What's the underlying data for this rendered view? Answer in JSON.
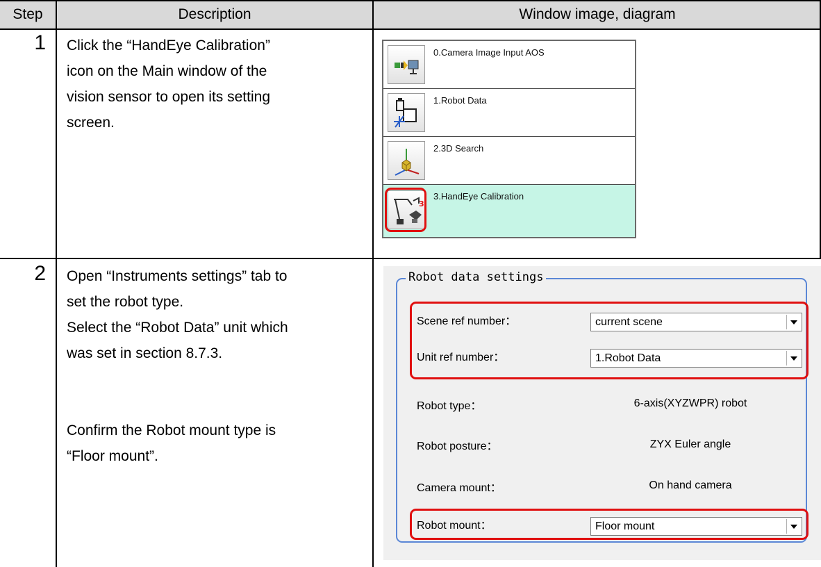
{
  "table": {
    "header": {
      "step": "Step",
      "description": "Description",
      "window_image": "Window image, diagram"
    },
    "steps": [
      {
        "number": "1",
        "lines": [
          "Click the “HandEye Calibration”",
          "icon on the Main window of the",
          "vision sensor to open its setting",
          "screen."
        ]
      },
      {
        "number": "2",
        "lines_a": [
          "Open “Instruments settings” tab to",
          "set the robot type.",
          "Select the “Robot Data” unit which",
          "was set in section 8.7.3."
        ],
        "lines_b": [
          "Confirm the Robot mount type is",
          "“Floor mount”."
        ]
      }
    ]
  },
  "unit_list": {
    "items": [
      {
        "label": "0.Camera Image Input AOS",
        "icon": "camera-input-icon",
        "selected": false
      },
      {
        "label": "1.Robot Data",
        "icon": "robot-data-icon",
        "selected": false
      },
      {
        "label": "2.3D Search",
        "icon": "3d-search-icon",
        "selected": false
      },
      {
        "label": "3.HandEye Calibration",
        "icon": "handeye-calibration-icon",
        "selected": true
      }
    ],
    "selected_color": "#c6f5e6",
    "highlight_color": "#e01010"
  },
  "robot_settings": {
    "group_title": "Robot data settings",
    "scene_ref": {
      "label": "Scene ref number：",
      "value": "current scene"
    },
    "unit_ref": {
      "label": "Unit ref number：",
      "value": "1.Robot Data"
    },
    "robot_type": {
      "label": "Robot type：",
      "value": "6-axis(XYZWPR) robot"
    },
    "robot_posture": {
      "label": "Robot posture：",
      "value": "ZYX Euler angle"
    },
    "camera_mount": {
      "label": "Camera mount：",
      "value": "On hand camera"
    },
    "robot_mount": {
      "label": "Robot mount：",
      "value": "Floor mount"
    },
    "group_border_color": "#5b87d6",
    "highlight_color": "#e01010"
  }
}
